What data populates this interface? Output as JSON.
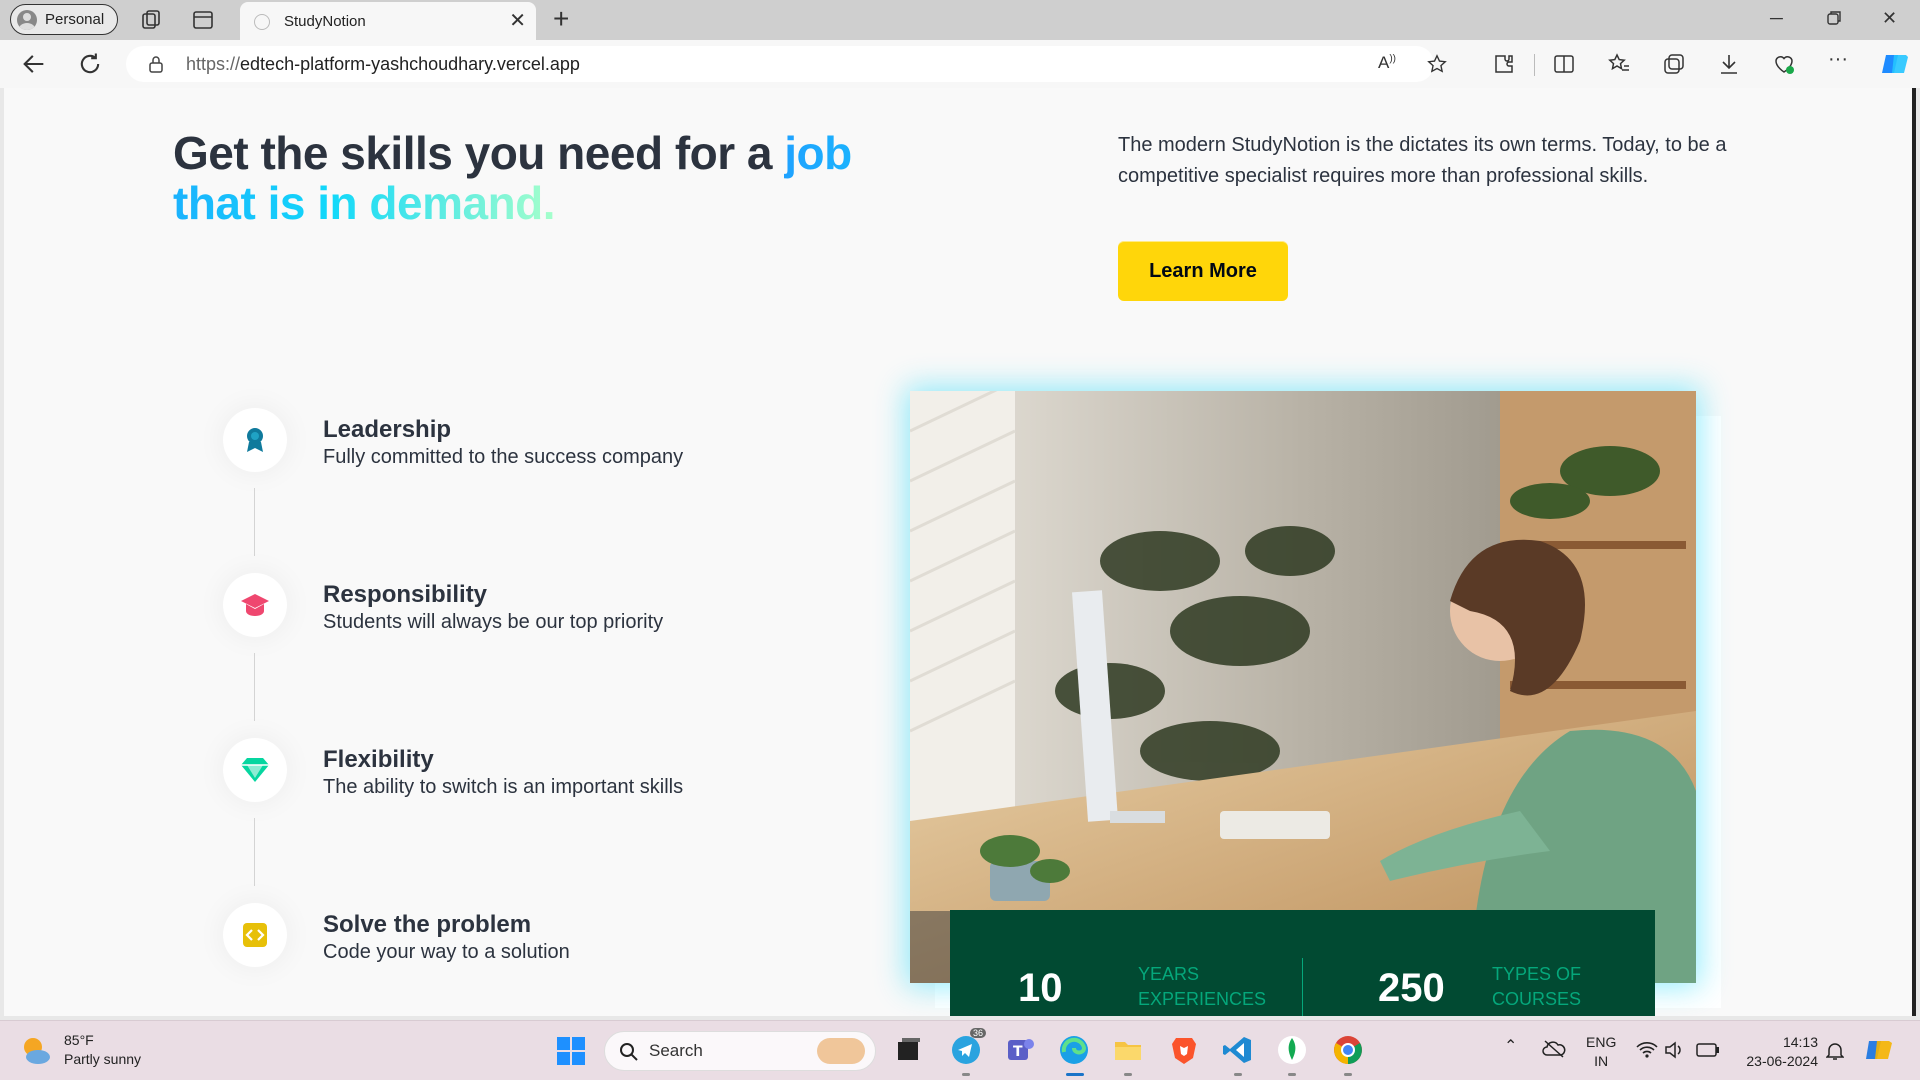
{
  "browser": {
    "profile_label": "Personal",
    "tab_title": "StudyNotion",
    "url_protocol": "https://",
    "url_host": "edtech-platform-yashchoudhary.vercel.app"
  },
  "hero": {
    "title_plain": "Get the skills you need for a ",
    "title_highlight": "job that is in demand.",
    "description": "The modern StudyNotion is the dictates its own terms. Today, to be a competitive specialist requires more than professional skills.",
    "cta_label": "Learn More",
    "cta_color": "#ffd60a"
  },
  "timeline": [
    {
      "title": "Leadership",
      "description": "Fully committed to the success company",
      "icon": "medal-icon",
      "color": "#0f7a9c"
    },
    {
      "title": "Responsibility",
      "description": "Students will always be our top priority",
      "icon": "graduation-cap-icon",
      "color": "#ef476f"
    },
    {
      "title": "Flexibility",
      "description": "The ability to switch is an important skills",
      "icon": "diamond-icon",
      "color": "#06d6a0"
    },
    {
      "title": "Solve the problem",
      "description": "Code your way to a solution",
      "icon": "code-icon",
      "color": "#e7c009"
    }
  ],
  "stats": {
    "years_value": "10",
    "years_label_1": "YEARS",
    "years_label_2": "EXPERIENCES",
    "courses_value": "250",
    "courses_label_1": "TYPES OF",
    "courses_label_2": "COURSES",
    "bg_color": "#014a32",
    "label_color": "#05a77b"
  },
  "taskbar": {
    "temperature": "85°F",
    "weather": "Partly sunny",
    "search_placeholder": "Search",
    "lang_1": "ENG",
    "lang_2": "IN",
    "time": "14:13",
    "date": "23-06-2024",
    "telegram_badge": "36"
  }
}
